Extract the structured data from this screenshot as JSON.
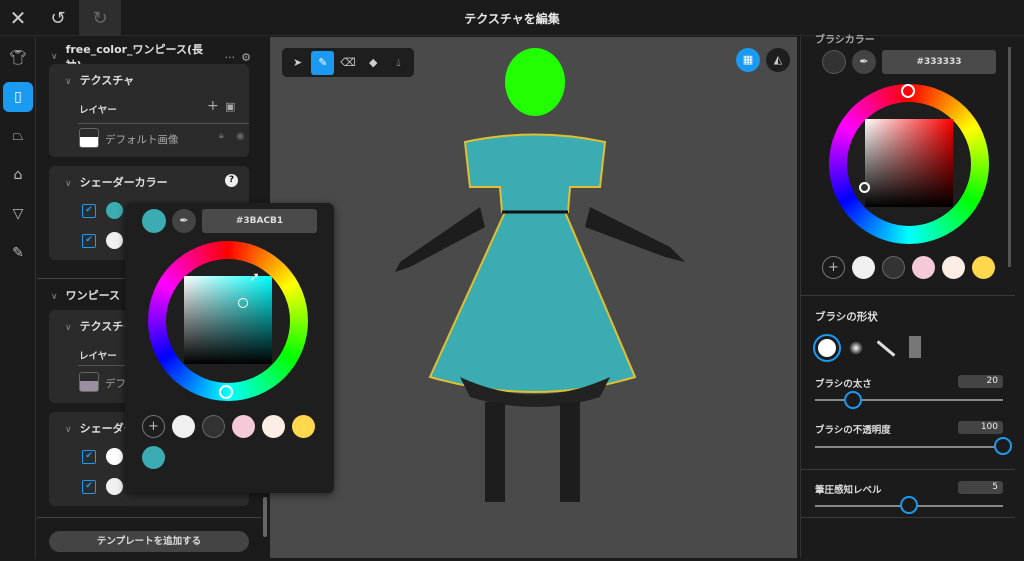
{
  "header": {
    "title": "テクスチャを編集",
    "close_icon": "close-icon",
    "undo_icon": "undo-icon",
    "redo_icon": "redo-icon"
  },
  "rail": [
    "shirt-icon",
    "onepiece-icon",
    "shoe-icon",
    "tanktop-icon",
    "underwear-icon",
    "brush-icon"
  ],
  "left": {
    "item1": {
      "title": "free_color_ワンピース(長袖)",
      "more": "···",
      "texture": {
        "title": "テクスチャ",
        "layer_label": "レイヤー",
        "layer_name": "デフォルト画像"
      },
      "shader": {
        "title": "シェーダーカラー",
        "help": "?",
        "colors": [
          "#3BACB1",
          "#F0F0F0"
        ]
      }
    },
    "item2": {
      "title": "ワンピース",
      "texture": {
        "title": "テクスチャ",
        "layer_label": "レイヤー",
        "layer_name": "デフォルト画像"
      },
      "shader": {
        "title": "シェーダーカラー",
        "colors": [
          "#FFFFFF",
          "#F0F0F0"
        ]
      }
    },
    "add_template": "テンプレートを追加する"
  },
  "popup": {
    "hex": "#3BACB1",
    "current": "#3BACB1",
    "swatches": [
      "#F0F0F0",
      "#333333",
      "#F4C9D8",
      "#FCEEE4",
      "#FFD84D",
      "#3BACB1"
    ]
  },
  "tools": [
    "select-tool",
    "pen-tool",
    "eraser-tool",
    "fill-tool",
    "dropper-tool"
  ],
  "right": {
    "color_title": "ブラシカラー",
    "hex": "#333333",
    "current": "#333333",
    "swatches": [
      "#F0F0F0",
      "#333333",
      "#F4C9D8",
      "#FCEEE4",
      "#FFD84D"
    ],
    "shape_title": "ブラシの形状",
    "size_label": "ブラシの太さ",
    "size": "20",
    "opacity_label": "ブラシの不透明度",
    "opacity": "100",
    "pressure_label": "筆圧感知レベル",
    "pressure": "5"
  }
}
